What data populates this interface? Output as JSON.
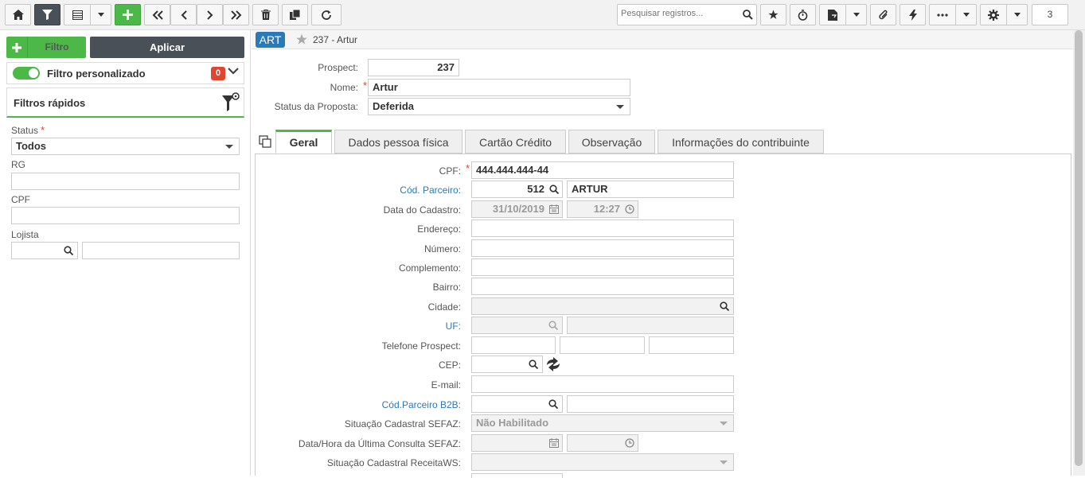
{
  "toolbar": {
    "search_placeholder": "Pesquisar registros...",
    "counter": "3"
  },
  "left": {
    "filtro_label": "Filtro",
    "aplicar_label": "Aplicar",
    "filtro_personalizado": "Filtro personalizado",
    "filtro_count": "0",
    "filtros_rapidos": "Filtros rápidos",
    "status_label": "Status",
    "status_value": "Todos",
    "rg_label": "RG",
    "cpf_label": "CPF",
    "lojista_label": "Lojista"
  },
  "header": {
    "badge": "ART",
    "title": "237 - Artur"
  },
  "form": {
    "prospect_label": "Prospect:",
    "prospect_value": "237",
    "nome_label": "Nome:",
    "nome_value": "Artur",
    "status_proposta_label": "Status da Proposta:",
    "status_proposta_value": "Deferida"
  },
  "tabs": [
    {
      "label": "Geral"
    },
    {
      "label": "Dados pessoa física"
    },
    {
      "label": "Cartão Crédito"
    },
    {
      "label": "Observação"
    },
    {
      "label": "Informações do contribuinte"
    }
  ],
  "geral": {
    "cpf_label": "CPF:",
    "cpf_value": "444.444.444-44",
    "cod_parceiro_label": "Cód. Parceiro:",
    "cod_parceiro_value": "512",
    "cod_parceiro_name": "ARTUR",
    "data_cadastro_label": "Data do Cadastro:",
    "data_cadastro_date": "31/10/2019",
    "data_cadastro_time": "12:27",
    "endereco_label": "Endereço:",
    "numero_label": "Número:",
    "complemento_label": "Complemento:",
    "bairro_label": "Bairro:",
    "cidade_label": "Cidade:",
    "uf_label": "UF:",
    "telefone_label": "Telefone Prospect:",
    "cep_label": "CEP:",
    "email_label": "E-mail:",
    "cod_parceiro_b2b_label": "Cód.Parceiro B2B:",
    "situacao_sefaz_label": "Situação Cadastral SEFAZ:",
    "situacao_sefaz_value": "Não Habilitado",
    "data_hora_sefaz_label": "Data/Hora da Última Consulta SEFAZ:",
    "situacao_receitaws_label": "Situação Cadastral ReceitaWS:"
  }
}
